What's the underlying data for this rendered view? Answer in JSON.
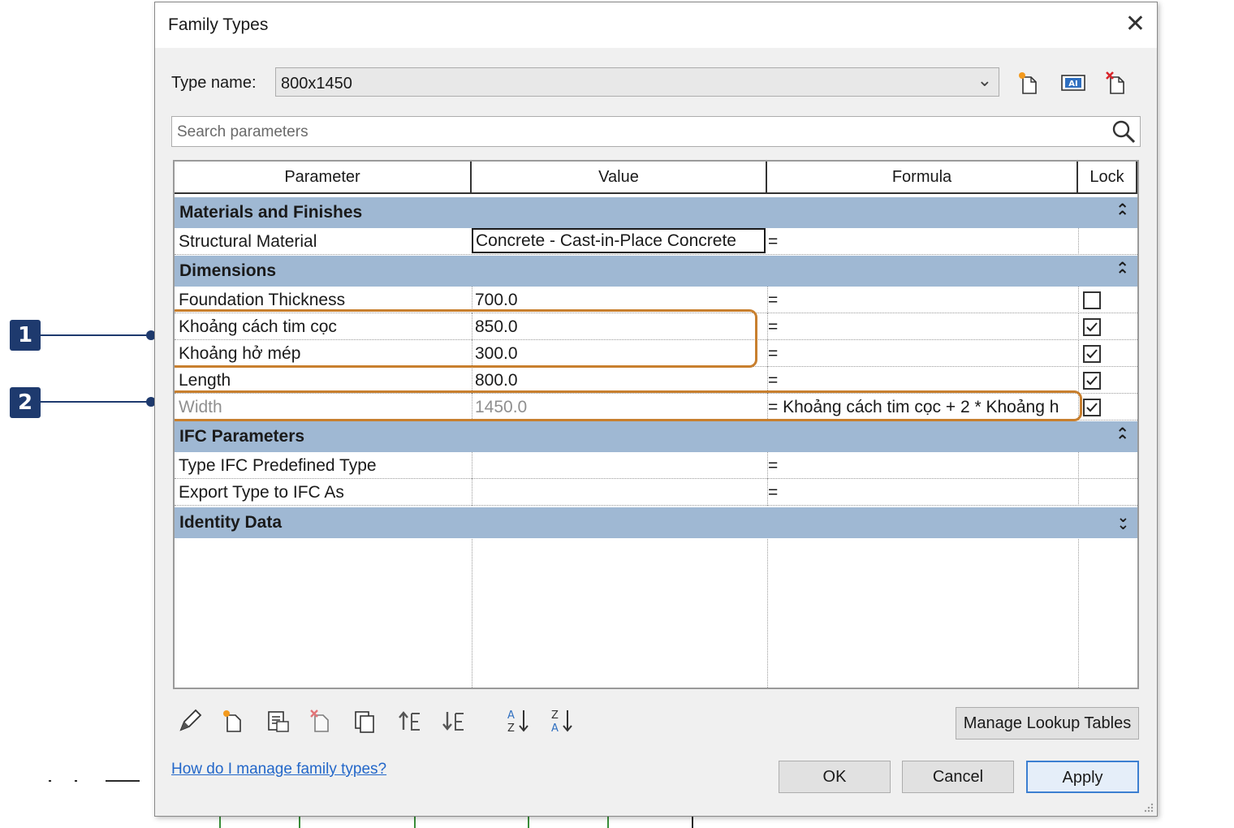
{
  "dialog": {
    "title": "Family Types",
    "type_name_label": "Type name:",
    "type_name_value": "800x1450",
    "search_placeholder": "Search parameters"
  },
  "columns": [
    "Parameter",
    "Value",
    "Formula",
    "Lock"
  ],
  "groups": [
    {
      "name": "Materials and Finishes",
      "collapse_icon": "chevron-double-up-icon",
      "rows": [
        {
          "parameter": "Structural Material",
          "value": "Concrete - Cast-in-Place Concrete",
          "formula": "=",
          "lock": null
        }
      ]
    },
    {
      "name": "Dimensions",
      "collapse_icon": "chevron-double-up-icon",
      "rows": [
        {
          "parameter": "Foundation Thickness",
          "value": "700.0",
          "formula": "=",
          "lock": false
        },
        {
          "parameter": "Khoảng cách tim cọc",
          "value": "850.0",
          "formula": "=",
          "lock": true
        },
        {
          "parameter": "Khoảng hở mép",
          "value": "300.0",
          "formula": "=",
          "lock": true
        },
        {
          "parameter": "Length",
          "value": "800.0",
          "formula": "=",
          "lock": true
        },
        {
          "parameter": "Width",
          "value": "1450.0",
          "formula": "= Khoảng cách tim cọc + 2 * Khoảng h",
          "lock": true
        }
      ]
    },
    {
      "name": "IFC Parameters",
      "collapse_icon": "chevron-double-up-icon",
      "rows": [
        {
          "parameter": "Type IFC Predefined Type",
          "value": "",
          "formula": "=",
          "lock": null
        },
        {
          "parameter": "Export Type to IFC As",
          "value": "",
          "formula": "=",
          "lock": null
        }
      ]
    },
    {
      "name": "Identity Data",
      "collapse_icon": "chevron-double-down-icon",
      "rows": []
    }
  ],
  "callouts": [
    "1",
    "2"
  ],
  "buttons": {
    "manage_lookup": "Manage Lookup Tables",
    "ok": "OK",
    "cancel": "Cancel",
    "apply": "Apply"
  },
  "help_link": "How do I manage family types?",
  "colors": {
    "group_header": "#9fb8d3",
    "highlight": "#c87f2e",
    "callout": "#1e3a6e",
    "link": "#2367c9"
  }
}
